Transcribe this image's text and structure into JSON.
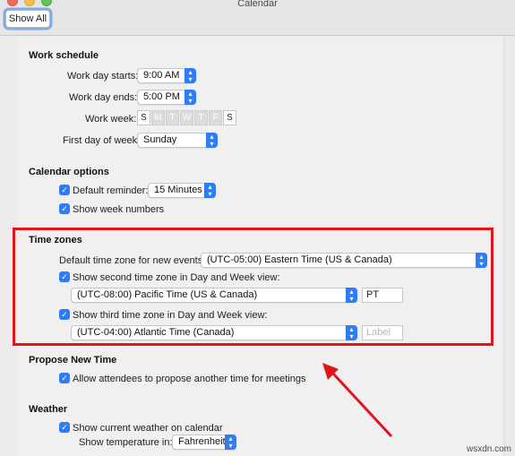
{
  "window": {
    "title": "Calendar",
    "show_all": "Show All"
  },
  "work_schedule": {
    "title": "Work schedule",
    "day_starts_label": "Work day starts:",
    "day_starts_value": "9:00 AM",
    "day_ends_label": "Work day ends:",
    "day_ends_value": "5:00 PM",
    "work_week_label": "Work week:",
    "days": [
      "S",
      "M",
      "T",
      "W",
      "T",
      "F",
      "S"
    ],
    "days_active": [
      true,
      false,
      false,
      false,
      false,
      false,
      true
    ],
    "first_day_label": "First day of week:",
    "first_day_value": "Sunday"
  },
  "calendar_options": {
    "title": "Calendar options",
    "default_reminder_label": "Default reminder:",
    "default_reminder_value": "15 Minutes",
    "show_week_numbers_label": "Show week numbers"
  },
  "time_zones": {
    "title": "Time zones",
    "default_tz_label": "Default time zone for new events:",
    "default_tz_value": "(UTC-05:00) Eastern Time (US & Canada)",
    "second_tz_label": "Show second time zone in Day and Week view:",
    "second_tz_value": "(UTC-08:00) Pacific Time (US & Canada)",
    "second_tz_label_value": "PT",
    "third_tz_label": "Show third time zone in Day and Week view:",
    "third_tz_value": "(UTC-04:00) Atlantic Time (Canada)",
    "third_tz_label_placeholder": "Label"
  },
  "propose_new_time": {
    "title": "Propose New Time",
    "allow_label": "Allow attendees to propose another time for meetings"
  },
  "weather": {
    "title": "Weather",
    "show_weather_label": "Show current weather on calendar",
    "temperature_label": "Show temperature in:",
    "temperature_value": "Fahrenheit"
  },
  "watermark": "wsxdn.com",
  "colors": {
    "accent": "#2f7cf6",
    "annotation": "#e0141b"
  }
}
